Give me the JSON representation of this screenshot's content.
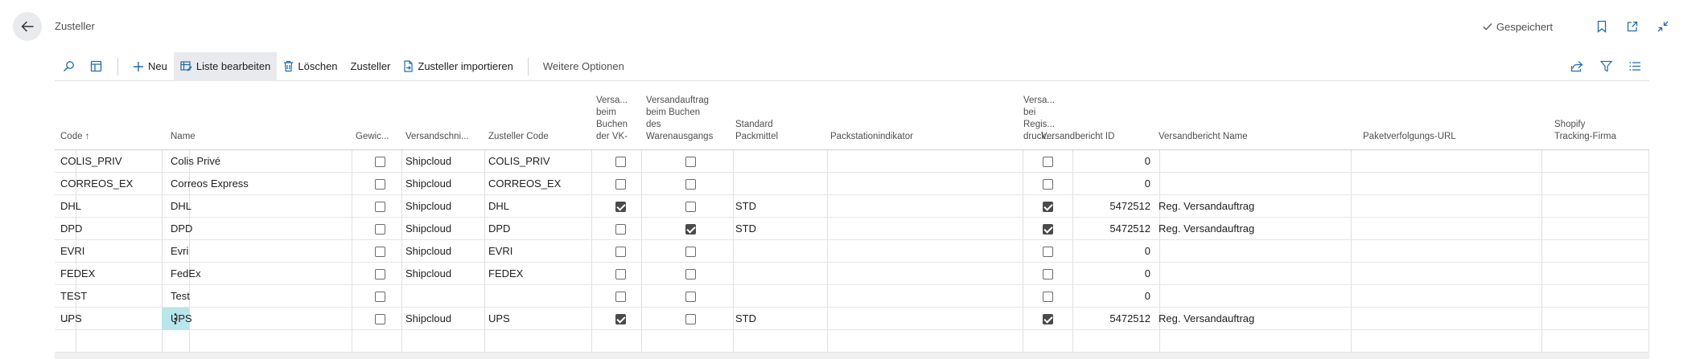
{
  "page": {
    "title": "Zusteller",
    "saved_label": "Gespeichert"
  },
  "toolbar": {
    "new": "Neu",
    "edit_list": "Liste bearbeiten",
    "delete": "Löschen",
    "carrier": "Zusteller",
    "import": "Zusteller importieren",
    "more": "Weitere Optionen"
  },
  "columns": [
    {
      "label": "Code ↑"
    },
    {
      "label": "Name"
    },
    {
      "label": "Gewic..."
    },
    {
      "label": "Versandschni..."
    },
    {
      "label": "Zusteller Code"
    },
    {
      "label": "Versa...\nbeim\nBuchen\nder VK-"
    },
    {
      "label": "Versandauftrag\nbeim Buchen\ndes\nWarenausgangs"
    },
    {
      "label": "Standard\nPackmittel"
    },
    {
      "label": "Packstationindikator"
    },
    {
      "label": "Versa...\nbei\nRegis...\ndruck..."
    },
    {
      "label": "Versandbericht ID"
    },
    {
      "label": "Versandbericht Name"
    },
    {
      "label": "Paketverfolgungs-URL"
    },
    {
      "label": "Shopify\nTracking-Firma"
    }
  ],
  "rows": [
    {
      "code": "COLIS_PRIV",
      "name": "Colis Privé",
      "weight": false,
      "interface": "Shipcloud",
      "carrier_code": "COLIS_PRIV",
      "ship_sales": false,
      "ship_warehouse": false,
      "packaging": "",
      "register_print": false,
      "report_id": "0",
      "report_name": ""
    },
    {
      "code": "CORREOS_EX",
      "name": "Correos Express",
      "weight": false,
      "interface": "Shipcloud",
      "carrier_code": "CORREOS_EX",
      "ship_sales": false,
      "ship_warehouse": false,
      "packaging": "",
      "register_print": false,
      "report_id": "0",
      "report_name": ""
    },
    {
      "code": "DHL",
      "name": "DHL",
      "weight": false,
      "interface": "Shipcloud",
      "carrier_code": "DHL",
      "ship_sales": true,
      "ship_warehouse": false,
      "packaging": "STD",
      "register_print": true,
      "report_id": "5472512",
      "report_name": "Reg. Versandauftrag"
    },
    {
      "code": "DPD",
      "name": "DPD",
      "weight": false,
      "interface": "Shipcloud",
      "carrier_code": "DPD",
      "ship_sales": false,
      "ship_warehouse": true,
      "packaging": "STD",
      "register_print": true,
      "report_id": "5472512",
      "report_name": "Reg. Versandauftrag"
    },
    {
      "code": "EVRI",
      "name": "Evri",
      "weight": false,
      "interface": "Shipcloud",
      "carrier_code": "EVRI",
      "ship_sales": false,
      "ship_warehouse": false,
      "packaging": "",
      "register_print": false,
      "report_id": "0",
      "report_name": ""
    },
    {
      "code": "FEDEX",
      "name": "FedEx",
      "weight": false,
      "interface": "Shipcloud",
      "carrier_code": "FEDEX",
      "ship_sales": false,
      "ship_warehouse": false,
      "packaging": "",
      "register_print": false,
      "report_id": "0",
      "report_name": ""
    },
    {
      "code": "TEST",
      "name": "Test",
      "weight": false,
      "interface": "",
      "carrier_code": "",
      "ship_sales": false,
      "ship_warehouse": false,
      "packaging": "",
      "register_print": false,
      "report_id": "0",
      "report_name": ""
    },
    {
      "code": "UPS",
      "name": "UPS",
      "weight": false,
      "interface": "Shipcloud",
      "carrier_code": "UPS",
      "ship_sales": true,
      "ship_warehouse": false,
      "packaging": "STD",
      "register_print": true,
      "report_id": "5472512",
      "report_name": "Reg. Versandauftrag",
      "current": true
    }
  ],
  "selected_row_indicator": "→",
  "row_menu_glyph": "⋮"
}
